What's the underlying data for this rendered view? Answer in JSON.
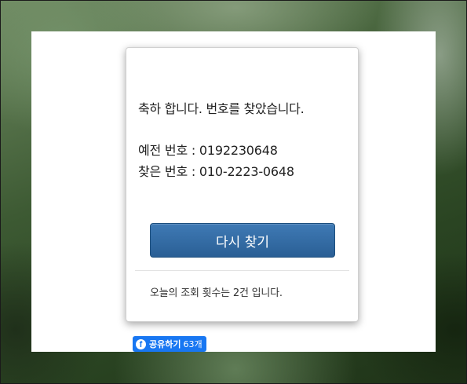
{
  "result": {
    "congrats_message": "축하 합니다. 번호를 찾았습니다.",
    "old_number_line": "예전 번호 : 0192230648",
    "new_number_line": "찾은 번호 : 010-2223-0648"
  },
  "actions": {
    "retry_label": "다시 찾기"
  },
  "footer": {
    "view_count_text": "오늘의 조회 횟수는 2건 입니다."
  },
  "share": {
    "icon": "facebook-icon",
    "label": "공유하기",
    "count": "63개",
    "color": "#1877f2"
  },
  "colors": {
    "button": "#2f6aa3",
    "card_background": "#ffffff"
  }
}
